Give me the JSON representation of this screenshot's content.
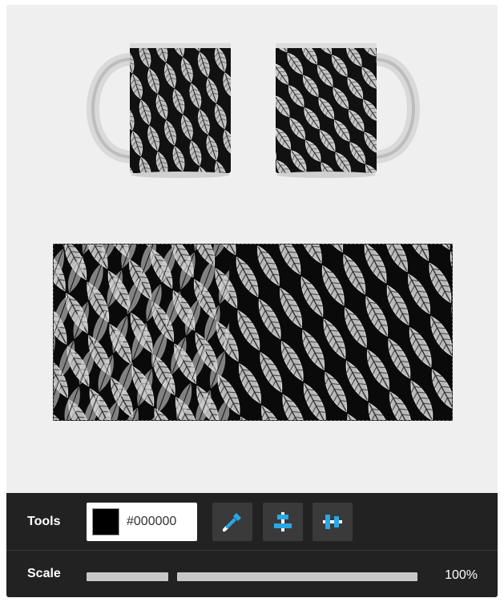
{
  "preview": {
    "left_mug": "mug-left-preview",
    "right_mug": "mug-right-preview"
  },
  "design": {
    "pattern": "feather-pattern"
  },
  "tools": {
    "label": "Tools",
    "color_value": "#000000",
    "swatch_color": "#000000",
    "buttons": [
      {
        "icon": "eyedropper-icon"
      },
      {
        "icon": "align-vertical-center-icon"
      },
      {
        "icon": "align-horizontal-center-icon"
      }
    ],
    "accent": "#29a8e6"
  },
  "scale": {
    "label": "Scale",
    "value": "100%"
  }
}
